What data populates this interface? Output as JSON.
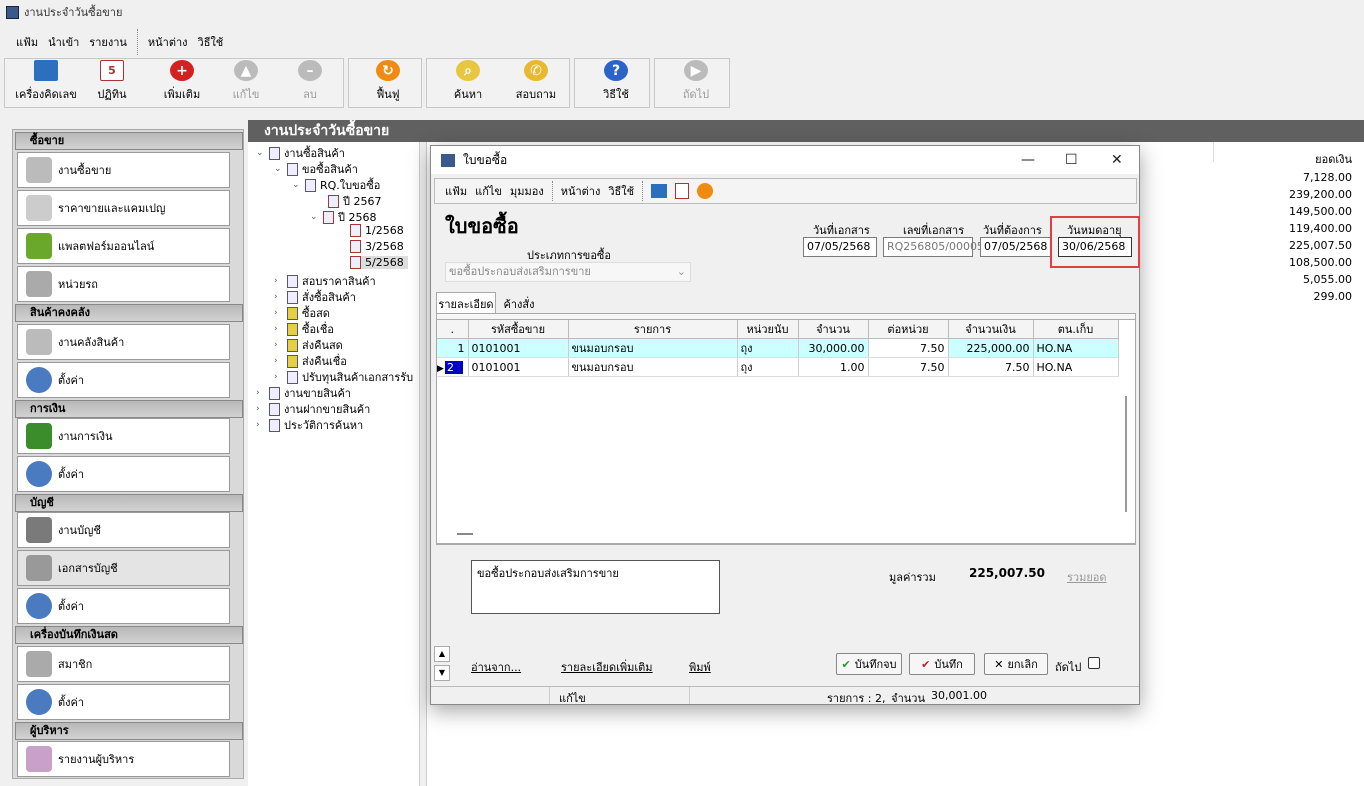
{
  "app": {
    "title": "งานประจำวันซื้อขาย"
  },
  "menu": [
    "แฟ้ม",
    "นำเข้า",
    "รายงาน",
    "หน้าต่าง",
    "วิธีใช้"
  ],
  "toolbar": {
    "calc": "เครื่องคิดเลข",
    "calendar": "ปฏิทิน",
    "add": "เพิ่มเติม",
    "edit": "แก้ไข",
    "delete": "ลบ",
    "restore": "ฟื้นฟู",
    "search": "ค้นหา",
    "inquiry": "สอบถาม",
    "help": "วิธีใช้",
    "next": "ถัดไป"
  },
  "sidebar": {
    "groups": [
      {
        "title": "ซื้อขาย",
        "items": [
          "งานซื้อขาย",
          "ราคาขายและแคมเปญ",
          "แพลตฟอร์มออนไลน์",
          "หน่วยรถ"
        ]
      },
      {
        "title": "สินค้าคงคลัง",
        "items": [
          "งานคลังสินค้า",
          "ตั้งค่า"
        ]
      },
      {
        "title": "การเงิน",
        "items": [
          "งานการเงิน",
          "ตั้งค่า"
        ]
      },
      {
        "title": "บัญชี",
        "items": [
          "งานบัญชี",
          "เอกสารบัญชี",
          "ตั้งค่า"
        ]
      },
      {
        "title": "เครื่องบันทึกเงินสด",
        "items": [
          "สมาชิก",
          "ตั้งค่า"
        ]
      },
      {
        "title": "ผู้บริหาร",
        "items": [
          "รายงานผู้บริหาร"
        ]
      }
    ]
  },
  "header": {
    "title": "งานประจำวันซื้อขาย"
  },
  "tree": [
    "งานซื้อสินค้า",
    "ขอซื้อสินค้า",
    "RQ.ใบขอซื้อ",
    "ปี 2567",
    "ปี 2568",
    "1/2568",
    "3/2568",
    "5/2568",
    "สอบราคาสินค้า",
    "สั่งซื้อสินค้า",
    "ซื้อสด",
    "ซื้อเชื่อ",
    "ส่งคืนสด",
    "ส่งคืนเชื่อ",
    "ปรับทุนสินค้าเอกสารรับ",
    "งานขายสินค้า",
    "งานฝากขายสินค้า",
    "ประวัติการค้นหา"
  ],
  "amounts": {
    "header": "ยอดเงิน",
    "values": [
      "7,128.00",
      "239,200.00",
      "149,500.00",
      "119,400.00",
      "225,007.50",
      "108,500.00",
      "5,055.00",
      "299.00"
    ]
  },
  "dialog": {
    "title": "ใบขอซื้อ",
    "menu": [
      "แฟ้ม",
      "แก้ไข",
      "มุมมอง",
      "หน้าต่าง",
      "วิธีใช้"
    ],
    "heading": "ใบขอซื้อ",
    "type_label": "ประเภทการขอซื้อ",
    "type_value": "ขอซื้อประกอบส่งเสริมการขาย",
    "doc_date_label": "วันที่เอกสาร",
    "doc_date": "07/05/2568",
    "doc_no_label": "เลขที่เอกสาร",
    "doc_no": "RQ256805/00005",
    "need_date_label": "วันที่ต้องการ",
    "need_date": "07/05/2568",
    "expire_label": "วันหมดอายุ",
    "expire_date": "30/06/2568",
    "tabs": [
      "รายละเอียด",
      "ค้างสั่ง"
    ],
    "columns": [
      ".",
      "รหัสซื้อขาย",
      "รายการ",
      "หน่วยนับ",
      "จำนวน",
      "ต่อหน่วย",
      "จำนวนเงิน",
      "ตน.เก็บ"
    ],
    "rows": [
      [
        "1",
        "0101001",
        "ขนมอบกรอบ",
        "ถุง",
        "30,000.00",
        "7.50",
        "225,000.00",
        "HO.NA"
      ],
      [
        "2",
        "0101001",
        "ขนมอบกรอบ",
        "ถุง",
        "1.00",
        "7.50",
        "7.50",
        "HO.NA"
      ]
    ],
    "note": "ขอซื้อประกอบส่งเสริมการขาย",
    "total_label": "มูลค่ารวม",
    "total": "225,007.50",
    "sum_link": "รวมยอด",
    "links": [
      "อ่านจาก...",
      "รายละเอียดเพิ่มเติม",
      "พิมพ์"
    ],
    "btn_save_close": "บันทึกจบ",
    "btn_save": "บันทึก",
    "btn_cancel": "ยกเลิก",
    "next_label": "ถัดไป",
    "status": {
      "mode": "แก้ไข",
      "items": "รายการ : 2,",
      "qty_label": "จำนวน :",
      "qty": "30,001.00"
    }
  }
}
